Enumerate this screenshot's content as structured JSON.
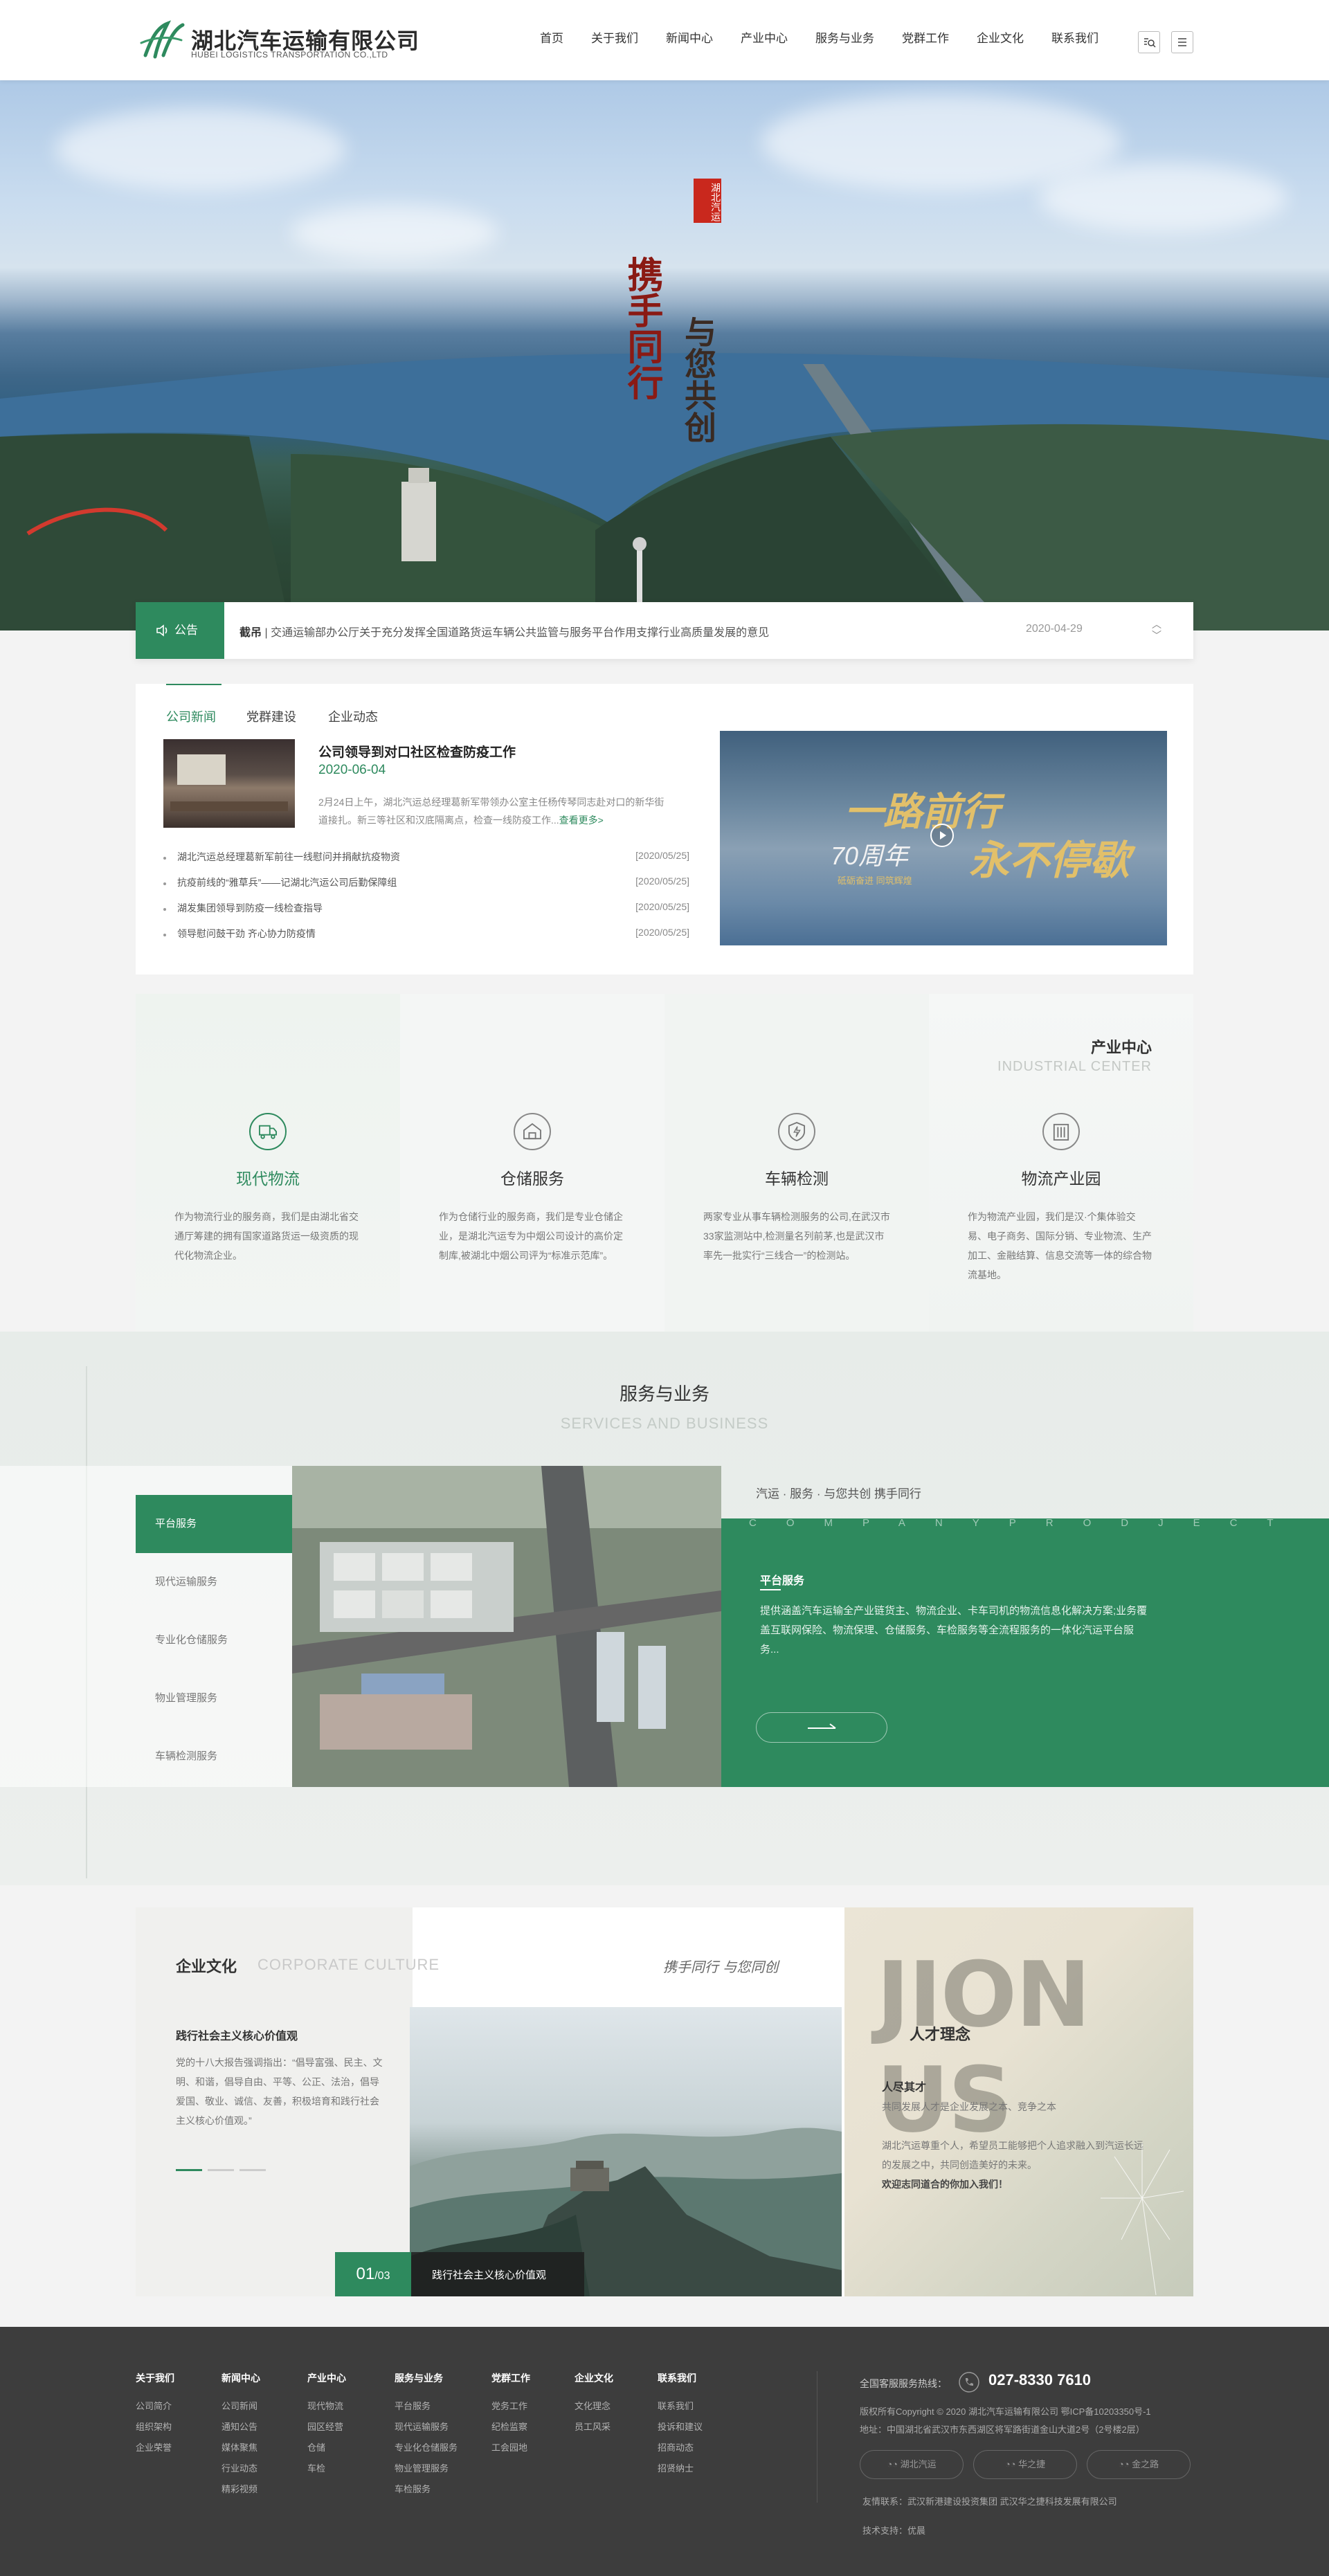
{
  "header": {
    "logo_cn": "湖北汽车运输有限公司",
    "logo_en": "HUBEI LOGISTICS TRANSPORTATION CO.,LTD",
    "nav": [
      "首页",
      "关于我们",
      "新闻中心",
      "产业中心",
      "服务与业务",
      "党群工作",
      "企业文化",
      "联系我们"
    ],
    "search_icon": "search-icon",
    "menu_icon": "menu-icon"
  },
  "banner": {
    "calligraphy_1": "携手同行",
    "calligraphy_2": "与您共创",
    "seal": "湖北汽运"
  },
  "notice": {
    "label": "公告",
    "text_bold": "截吊",
    "text": "交通运输部办公厅关于充分发挥全国道路货运车辆公共监管与服务平台作用支撑行业高质量发展的意见",
    "date": "2020-04-29"
  },
  "news": {
    "tabs": [
      "公司新闻",
      "党群建设",
      "企业动态"
    ],
    "featured": {
      "title": "公司领导到对口社区检查防疫工作",
      "date": "2020-06-04",
      "summary": "2月24日上午，湖北汽运总经理葛新军带领办公室主任杨传琴同志赴对口的新华街道接扎。新三等社区和汉底隔离点，检查一线防疫工作...",
      "more": "查看更多>"
    },
    "items": [
      {
        "title": "湖北汽运总经理葛新军前往一线慰问并捐献抗疫物资",
        "date": "[2020/05/25]"
      },
      {
        "title": "抗疫前线的“雅草兵”——记湖北汽运公司后勤保障组",
        "date": "[2020/05/25]"
      },
      {
        "title": "湖发集团领导到防疫一线检查指导",
        "date": "[2020/05/25]"
      },
      {
        "title": "领导慰问鼓干劲 齐心协力防疫情",
        "date": "[2020/05/25]"
      }
    ],
    "video": {
      "headline_1": "一路前行",
      "headline_2": "永不停歇",
      "years": "70周年",
      "caption": "砥砺奋进 同筑辉煌"
    }
  },
  "industry": {
    "heading": "产业中心",
    "heading_en": "INDUSTRIAL CENTER",
    "items": [
      {
        "title": "现代物流",
        "desc": "作为物流行业的服务商，我们是由湖北省交通厅筹建的拥有国家道路货运一级资质的现代化物流企业。",
        "icon": "truck-icon"
      },
      {
        "title": "仓储服务",
        "desc": "作为仓储行业的服务商，我们是专业仓储企业，是湖北汽运专为中烟公司设计的高价定制库,被湖北中烟公司评为“标准示范库”。",
        "icon": "warehouse-icon"
      },
      {
        "title": "车辆检测",
        "desc": "两家专业从事车辆检测服务的公司,在武汉市33家监测站中,检测量名列前茅,也是武汉市率先一批实行“三线合一”的检测站。",
        "icon": "shield-icon"
      },
      {
        "title": "物流产业园",
        "desc": "作为物流产业园，我们是汉·个集体验交易、电子商务、国际分销、专业物流、生产加工、金融结算、信息交流等一体的综合物流基地。",
        "icon": "building-icon"
      }
    ]
  },
  "services": {
    "title": "服务与业务",
    "title_en": "SERVICES AND BUSINESS",
    "menu": [
      "平台服务",
      "现代运输服务",
      "专业化仓储服务",
      "物业管理服务",
      "车辆检测服务"
    ],
    "active_index": 0,
    "slogan": "汽运 · 服务 · 与您共创 携手同行",
    "letters": "COMPANYPRODJECT",
    "panel_title": "平台服务",
    "panel_desc": "提供涵盖汽车运输全产业链货主、物流企业、卡车司机的物流信息化解决方案;业务覆盖互联网保险、物流保理、仓储服务、车检服务等全流程服务的一体化汽运平台服务...",
    "more_icon": "arrow-right-icon"
  },
  "culture": {
    "title": "企业文化",
    "title_en": "CORPORATE CULTURE",
    "slogan": "携手同行  与您同创",
    "sub": "践行社会主义核心价值观",
    "text": "党的十八大报告强调指出：“倡导富强、民主、文明、和谐，倡导自由、平等、公正、法治，倡导爱国、敬业、诚信、友善，积极培育和践行社会主义核心价值观。”",
    "counter": "01",
    "counter_total": "/03",
    "caption": "践行社会主义核心价值观"
  },
  "joinus": {
    "big": "JION US",
    "title": "人才理念",
    "sub": "人尽其才",
    "sub2": "共同发展人才是企业发展之本、竞争之本",
    "desc": "湖北汽运尊重个人，希望员工能够把个人追求融入到汽运长远的发展之中，共同创造美好的未来。",
    "desc_bold": "欢迎志同道合的你加入我们！"
  },
  "footer": {
    "columns": [
      {
        "head": "关于我们",
        "links": [
          "公司简介",
          "组织架构",
          "企业荣誉"
        ]
      },
      {
        "head": "新闻中心",
        "links": [
          "公司新闻",
          "通知公告",
          "媒体聚焦",
          "行业动态",
          "精彩视频"
        ]
      },
      {
        "head": "产业中心",
        "links": [
          "现代物流",
          "园区经营",
          "仓储",
          "车检"
        ]
      },
      {
        "head": "服务与业务",
        "links": [
          "平台服务",
          "现代运输服务",
          "专业化仓储服务",
          "物业管理服务",
          "车检服务"
        ]
      },
      {
        "head": "党群工作",
        "links": [
          "党务工作",
          "纪检监察",
          "工会园地"
        ]
      },
      {
        "head": "企业文化",
        "links": [
          "文化理念",
          "员工风采"
        ]
      },
      {
        "head": "联系我们",
        "links": [
          "联系我们",
          "投诉和建议",
          "招商动态",
          "招贤纳士"
        ]
      }
    ],
    "hotline_label": "全国客服服务热线：",
    "phone": "027-8330 7610",
    "copyright": "版权所有Copyright © 2020 湖北汽车运输有限公司   鄂ICP备10203350号-1",
    "address": "地址：中国湖北省武汉市东西湖区将军路街道金山大道2号（2号楼2层）",
    "social": [
      "湖北汽运",
      "华之捷",
      "金之路"
    ],
    "links": "友情联系：武汉新港建设投资集团  武汉华之捷科技发展有限公司",
    "tech": "技术支持：优晨"
  }
}
